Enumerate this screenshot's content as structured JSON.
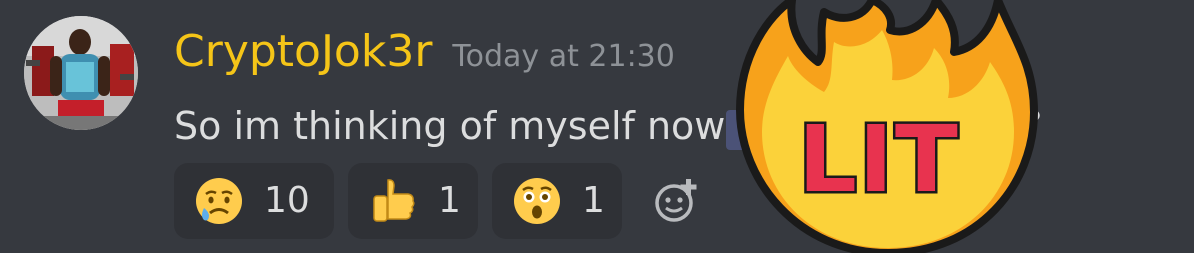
{
  "message": {
    "username": "CryptoJok3r",
    "timestamp": "Today at 21:30",
    "text": "So im thinking of myself now",
    "trailing_char": "?",
    "user_color": "#f5c518"
  },
  "reactions": [
    {
      "emoji": "crying-face",
      "count": "10"
    },
    {
      "emoji": "thumbs-up",
      "count": "1"
    },
    {
      "emoji": "astonished-face",
      "count": "1"
    }
  ],
  "sticker": {
    "icon": "fire-icon",
    "text": "LIT"
  },
  "colors": {
    "background": "#36393f",
    "reaction_bg": "#2f3136",
    "text": "#dcddde",
    "muted": "#8e9297"
  }
}
